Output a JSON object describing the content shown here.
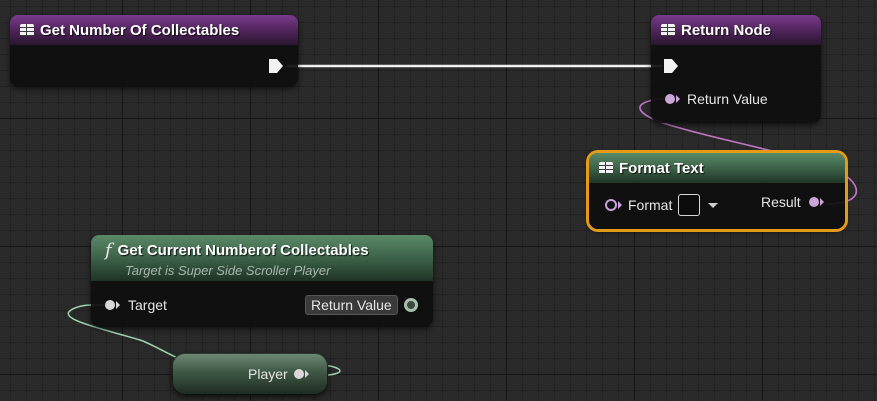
{
  "nodes": {
    "get_number": {
      "title": "Get Number Of Collectables"
    },
    "return_node": {
      "title": "Return Node",
      "pin_return_value": "Return Value"
    },
    "format_text": {
      "title": "Format Text",
      "pin_format": "Format",
      "pin_result": "Result"
    },
    "get_current": {
      "title": "Get Current Numberof Collectables",
      "subtitle": "Target is Super Side Scroller Player",
      "pin_target": "Target",
      "pin_return_value": "Return Value"
    },
    "player_var": {
      "label": "Player"
    }
  },
  "colors": {
    "exec_wire": "#ffffff",
    "text_wire": "#d87fd8",
    "object_wire": "#9ed3b1",
    "selection": "#e69b17",
    "function_header_purple": "#5a2a68",
    "pure_header_green": "#4a7456"
  },
  "icons": {
    "event_icon": "table-icon",
    "function_icon": "f-icon"
  }
}
